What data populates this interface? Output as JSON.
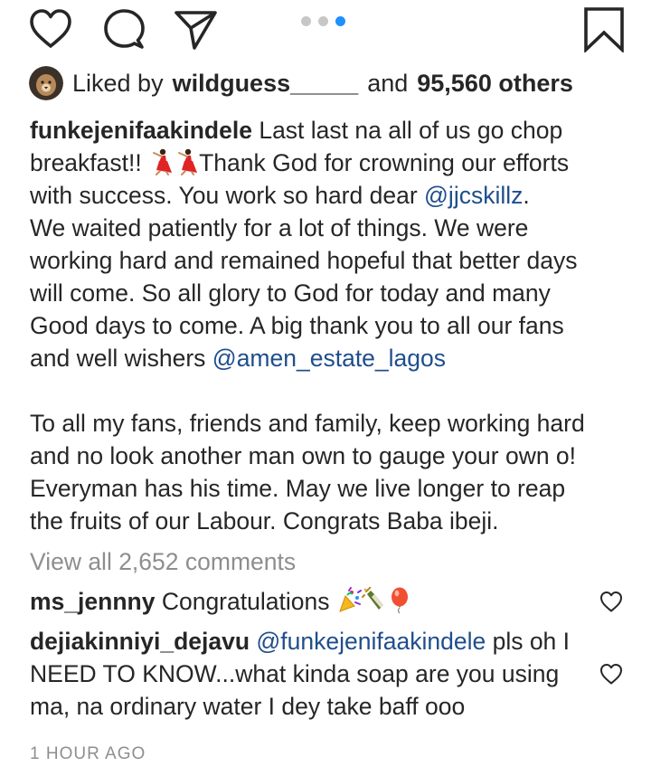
{
  "post": {
    "liked_by_prefix": "Liked by",
    "liked_by_user": "wildguess_____",
    "liked_by_and": "and",
    "likes_others": "95,560 others",
    "caption": {
      "username": "funkejenifaakindele",
      "l1_text": "Last last na all of us go chop",
      "l2_a": "breakfast!!",
      "l2_b": "Thank God for crowning our efforts",
      "l3_a": "with success. You work so hard dear",
      "l3_mention": "@jjcskillz",
      "l3_b": ".",
      "l4": "We waited patiently for a lot of things. We were",
      "l5": "working hard and remained hopeful that better days",
      "l6": "will come. So all glory to God for today and many",
      "l7": "Good days to come. A big thank you to all our fans",
      "l8_a": "and well wishers",
      "l8_mention": "@amen_estate_lagos",
      "p2_l1": "To all my fans, friends and family, keep working hard",
      "p2_l2": "and no look another man own to gauge your own o!",
      "p2_l3": "Everyman has his time. May we live longer to reap",
      "p2_l4": "the fruits of our Labour. Congrats Baba ibeji."
    },
    "view_all_comments": "View all 2,652 comments",
    "comments": [
      {
        "username": "ms_jennny",
        "text": "Congratulations"
      },
      {
        "username": "dejiakinniyi_dejavu",
        "mention": "@funkejenifaakindele",
        "text_a": "pls oh I",
        "text_b": "NEED TO KNOW...what kinda soap are you using",
        "text_c": "ma, na ordinary water I dey take baff ooo"
      }
    ],
    "timestamp": "1 HOUR AGO"
  },
  "carousel": {
    "count": 3,
    "active_index": 2
  },
  "icons": {
    "like": "heart-icon",
    "comment": "comment-bubble-icon",
    "share": "paper-plane-icon",
    "save": "bookmark-icon",
    "dancer": "woman-dancing-emoji",
    "confetti": "party-popper-emoji",
    "champagne": "champagne-bottle-emoji",
    "balloon": "balloon-emoji"
  },
  "colors": {
    "text": "#262626",
    "muted": "#8e8e8e",
    "mention": "#1f4e8c",
    "active_dot": "#1e90ff",
    "inactive_dot": "#c7c7c7"
  }
}
